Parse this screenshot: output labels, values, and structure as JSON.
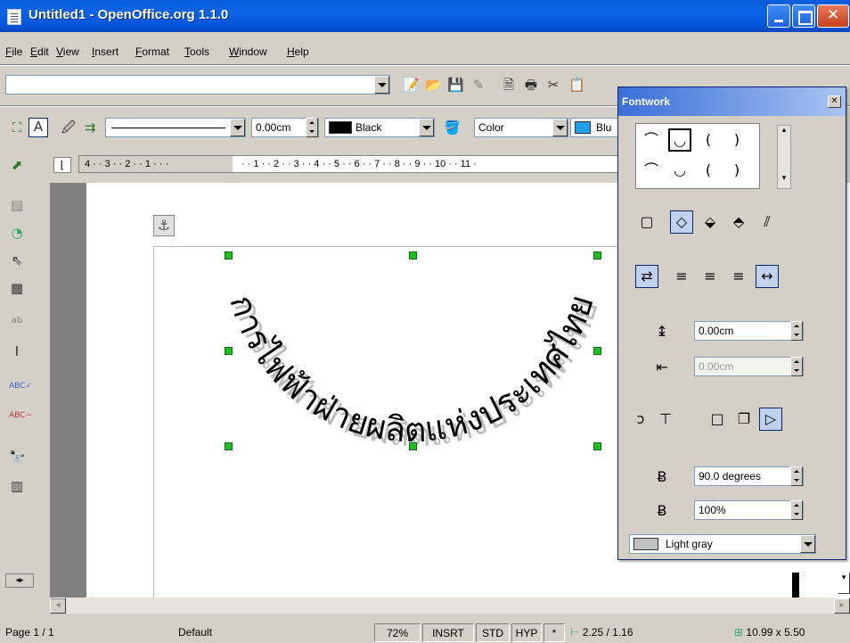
{
  "window": {
    "title": "Untitled1 - OpenOffice.org 1.1.0"
  },
  "menu": [
    "File",
    "Edit",
    "View",
    "Insert",
    "Format",
    "Tools",
    "Window",
    "Help"
  ],
  "draw_toolbar": {
    "line_width": "0.00cm",
    "line_color": "Black",
    "line_color_hex": "#000000",
    "fill_type": "Color",
    "fill_color": "Blu",
    "fill_color_hex": "#1ea0e8"
  },
  "ruler": {
    "left": "4 · · 3 · · 2 · · 1 · · ·",
    "right": "· · 1 · · 2 · · 3 · · 4 · · 5 · · 6 · · 7 · · 8 · · 9 · · 10 · · 11 ·"
  },
  "document": {
    "fontwork_text": "การไฟฟ้าฝ่ายผลิตแห่งประเทศไทย"
  },
  "status": {
    "page": "Page 1 / 1",
    "style": "Default",
    "zoom": "72%",
    "insert_mode": "INSRT",
    "selection_mode": "STD",
    "hyperlink_mode": "HYP",
    "modified": "*",
    "position": "2.25 / 1.16",
    "size": "10.99 x 5.50"
  },
  "fontwork": {
    "title": "Fontwork",
    "distance": "0.00cm",
    "indent": "0.00cm",
    "angle": "90.0 degrees",
    "size": "100%",
    "shadow_color": "Light gray",
    "shadow_color_hex": "#c0c0c0"
  }
}
